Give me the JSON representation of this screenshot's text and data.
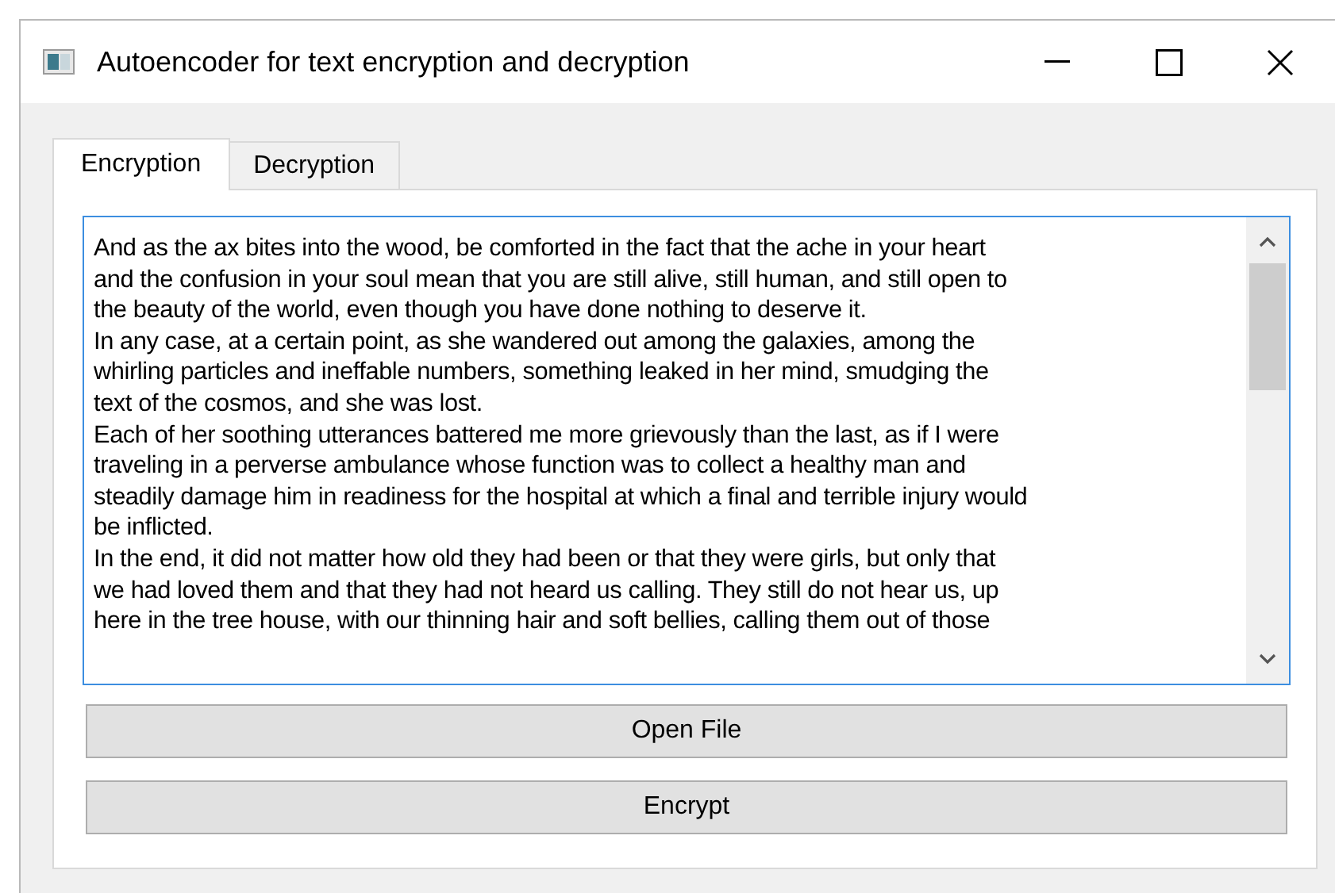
{
  "window": {
    "title": "Autoencoder for text encryption and decryption"
  },
  "tabs": [
    {
      "label": "Encryption",
      "selected": true
    },
    {
      "label": "Decryption",
      "selected": false
    }
  ],
  "text_area": {
    "lines": [
      "And as the ax bites into the wood, be comforted in the fact that the ache in your heart",
      "and the confusion in your soul mean that you are still alive, still human, and still open to",
      "the beauty of the world, even though you have done nothing to deserve it.",
      "In any case, at a certain point, as she wandered out among the galaxies, among the",
      "whirling particles and ineffable numbers, something leaked in her mind, smudging the",
      "text of the cosmos, and she was lost.",
      "Each of her soothing utterances battered me more grievously than the last, as if I were",
      "traveling in a perverse ambulance whose function was to collect a healthy man and",
      "steadily damage him in readiness for the hospital at which a final and terrible injury would",
      "be inflicted.",
      "In the end, it did not matter how old they had been or that they were girls, but only that",
      "we had loved them and that they had not heard us calling. They still do not hear us, up",
      "here in the tree house, with our thinning hair and soft bellies, calling them out of those"
    ]
  },
  "buttons": [
    {
      "label": "Open File"
    },
    {
      "label": "Encrypt"
    }
  ]
}
